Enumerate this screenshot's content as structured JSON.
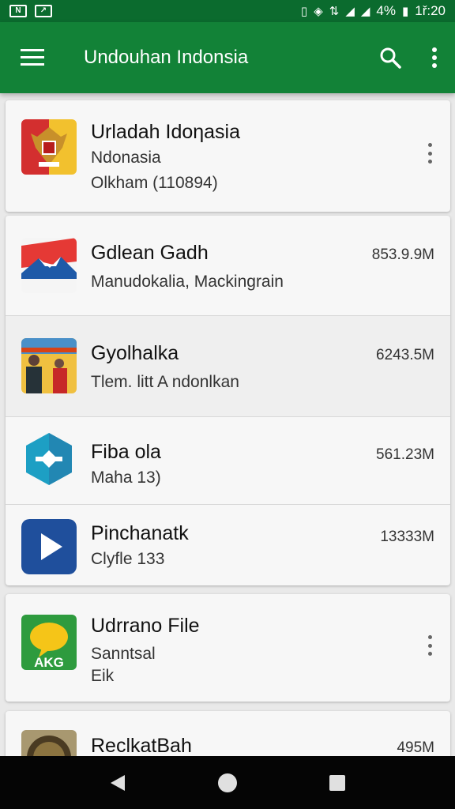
{
  "status_bar": {
    "battery": "4%",
    "time": "1ř:20"
  },
  "app_bar": {
    "title": "Undouhan Indonsia"
  },
  "cards": [
    {
      "title": "Urladah Idoηasia",
      "line1": "Ndonasia",
      "line2": "Olkham (110894)"
    },
    {
      "title": "Gdlean Gadh",
      "line1": "Manudokalia, Mackingrain",
      "size": "853.9.9M"
    },
    {
      "title": "Gyolhalka",
      "line1": "Tlem. litt A ndonlkan",
      "size": "6243.5M"
    },
    {
      "title": "Fiba ola",
      "line1": "Maha 13)",
      "size": "561.23M"
    },
    {
      "title": "Pinchanatk",
      "line1": "Clyfle 133",
      "size": "13333M"
    },
    {
      "title": "Udrrano File",
      "line1": "Sanntsal",
      "line2": "Eik",
      "icon_text": "AKG"
    },
    {
      "title": "ReclkatBah",
      "size": "495M"
    }
  ],
  "colors": {
    "status_bar": "#0b6b2e",
    "app_bar": "#128237",
    "nav_bar": "#050505"
  }
}
